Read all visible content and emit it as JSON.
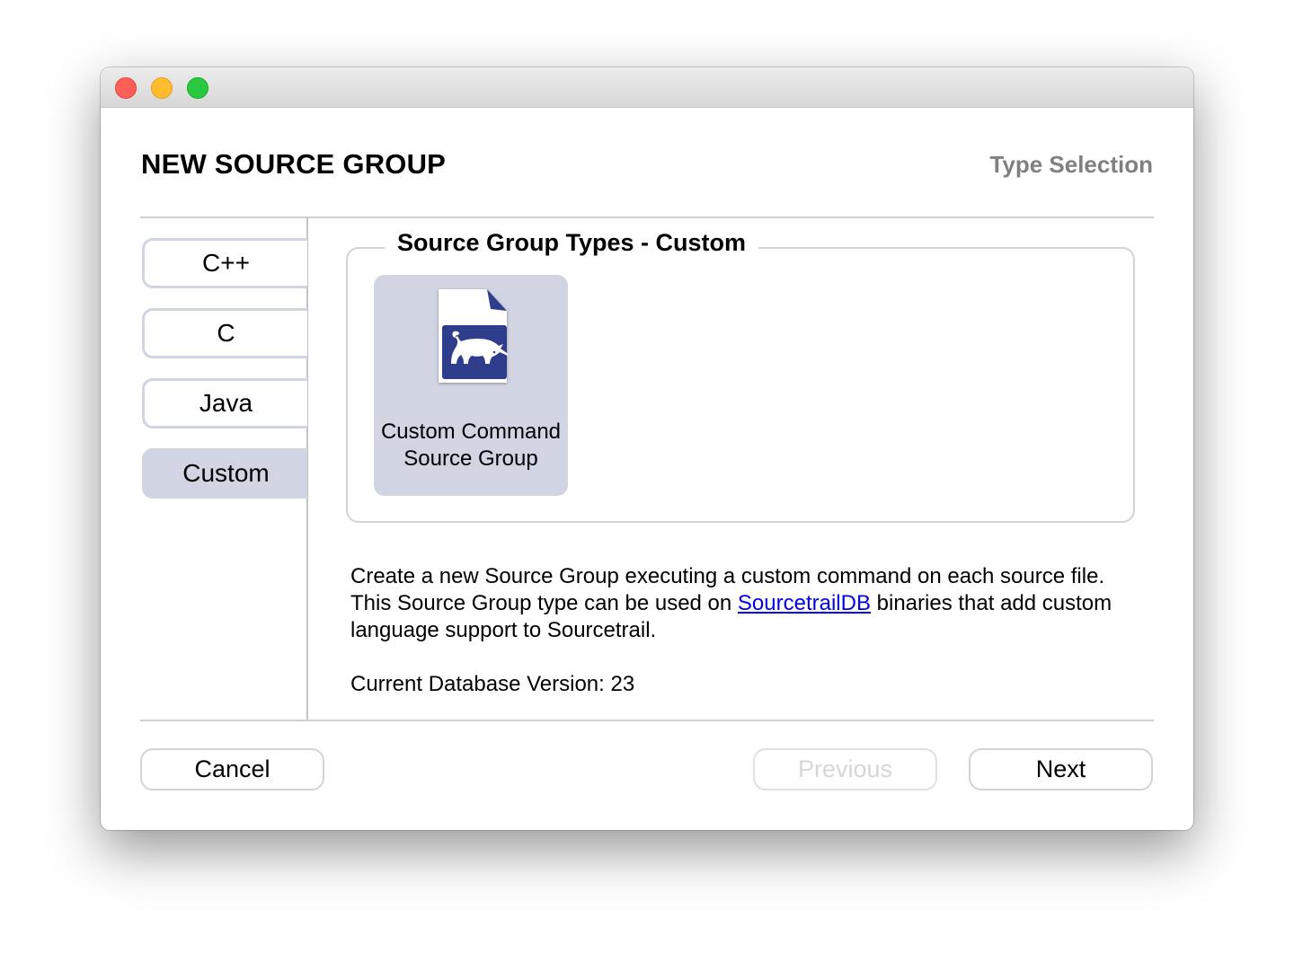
{
  "window": {
    "controls": [
      {
        "name": "close",
        "color": "#fe5f57"
      },
      {
        "name": "minimize",
        "color": "#febc2e"
      },
      {
        "name": "maximize",
        "color": "#28c840"
      }
    ]
  },
  "header": {
    "title": "NEW SOURCE GROUP",
    "step": "Type Selection"
  },
  "sidebar": {
    "tabs": [
      {
        "label": "C++",
        "active": false
      },
      {
        "label": "C",
        "active": false
      },
      {
        "label": "Java",
        "active": false
      },
      {
        "label": "Custom",
        "active": true
      }
    ]
  },
  "main": {
    "group_title": "Source Group Types - Custom",
    "types": [
      {
        "label_line1": "Custom Command",
        "label_line2": "Source Group",
        "icon": "sourcetrail-file-icon",
        "selected": true
      }
    ],
    "description": {
      "before_link": "Create a new Source Group executing a custom command on each source file. This Source Group type can be used on ",
      "link_text": "SourcetrailDB",
      "after_link": " binaries that add custom language support to Sourcetrail."
    },
    "db_version": "Current Database Version: 23"
  },
  "footer": {
    "cancel_label": "Cancel",
    "previous_label": "Previous",
    "previous_enabled": false,
    "next_label": "Next"
  },
  "colors": {
    "accent_selected": "#d1d4e2",
    "link": "#0000ee",
    "icon_blue": "#2e3d8c",
    "step_gray": "#808080"
  }
}
